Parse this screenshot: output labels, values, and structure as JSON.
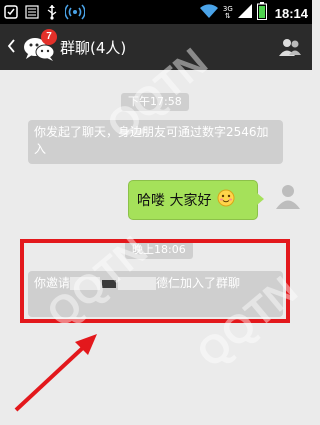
{
  "status_bar": {
    "network": "3G",
    "time": "18:14",
    "icons": [
      "notification-icon",
      "tasks-icon",
      "usb-icon",
      "wifi-hotspot-icon",
      "wifi-icon",
      "signal-icon",
      "battery-icon"
    ]
  },
  "title_bar": {
    "title": "群聊(4人)",
    "unread_badge": "7",
    "back_icon": "chevron-left-icon",
    "avatar_icon": "group-chat-avatar-icon",
    "right_icon": "contacts-icon"
  },
  "messages": {
    "time_1": "下午17:58",
    "system_1": "你发起了聊天，身边朋友可通过数字2546加入",
    "my_message": "哈喽  大家好",
    "my_message_emoji": "smiley-emoji",
    "time_2": "晚上18:06",
    "system_2_part1": "你邀请",
    "system_2_part2": "德仁加入了群聊"
  },
  "colors": {
    "status_bar_bg": "#000000",
    "title_bar_bg": "#2b2b2b",
    "chat_bg": "#ebebeb",
    "system_pill_bg": "#cfcfcf",
    "my_bubble_bg": "#a5e15a",
    "highlight": "#e3181c",
    "badge": "#e3302a"
  }
}
